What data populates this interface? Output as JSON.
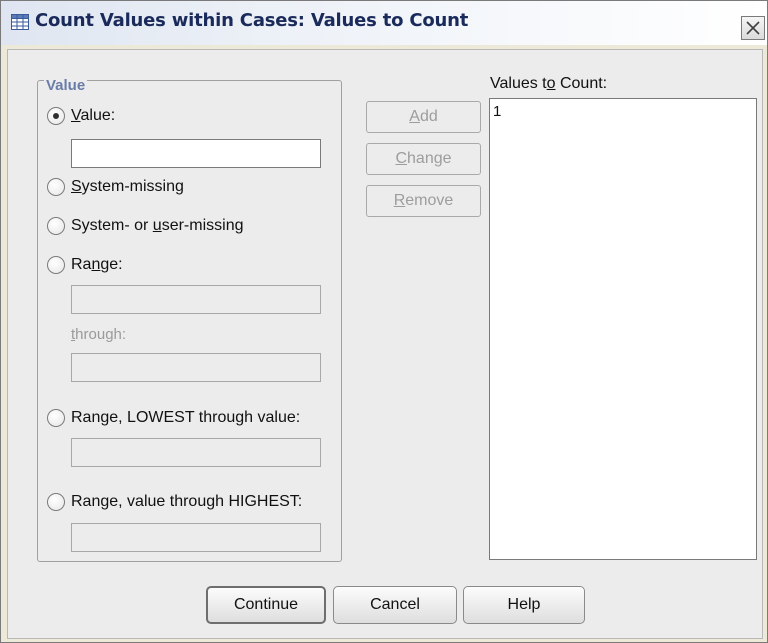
{
  "window": {
    "title": "Count Values within Cases: Values to Count",
    "icon": "table-icon",
    "close_icon": "close-icon"
  },
  "value_group": {
    "title": "Value",
    "options": [
      {
        "pre": "",
        "mnemonic": "V",
        "post": "alue:",
        "checked": true
      },
      {
        "pre": "",
        "mnemonic": "S",
        "post": "ystem-missing",
        "checked": false
      },
      {
        "pre": "System- or ",
        "mnemonic": "u",
        "post": "ser-missing",
        "checked": false
      },
      {
        "pre": "Ra",
        "mnemonic": "n",
        "post": "ge:",
        "checked": false
      },
      {
        "pre": "Ran",
        "mnemonic": "g",
        "post": "e, LOWEST through value:",
        "checked": false
      },
      {
        "pre": "Ran",
        "mnemonic": "g",
        "post": "e, value through HIGHEST:",
        "checked": false
      }
    ],
    "value_input": "",
    "range_low": "",
    "through": {
      "mnemonic": "t",
      "post": "hrough:"
    },
    "range_high": "",
    "lowest_value": "",
    "highest_value": ""
  },
  "buttons": {
    "add": {
      "mnemonic": "A",
      "post": "dd"
    },
    "change": {
      "mnemonic": "C",
      "post": "hange"
    },
    "remove": {
      "mnemonic": "R",
      "post": "emove"
    }
  },
  "values_to_count": {
    "label_pre": "Values t",
    "label_mnemonic": "o",
    "label_post": " Count:",
    "items": [
      "1"
    ]
  },
  "footer": {
    "continue": "Continue",
    "cancel": "Cancel",
    "help": "Help"
  }
}
